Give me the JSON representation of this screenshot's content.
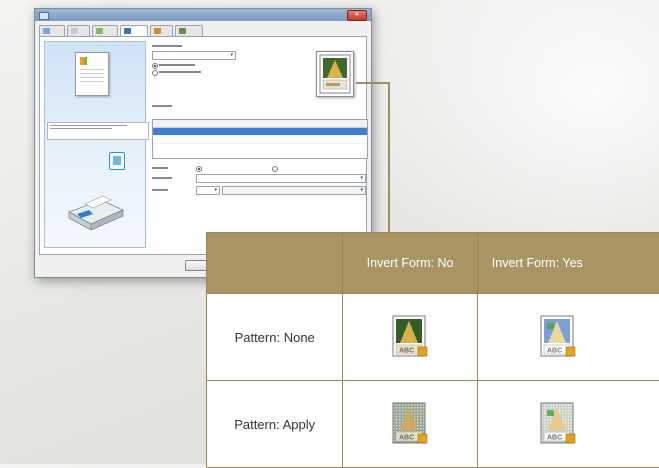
{
  "colors": {
    "table_header": "#a89563",
    "table_border": "#9c8457",
    "connector": "#a08d62",
    "dialog_accent": "#3f7fcf"
  },
  "icons": {
    "form_thumbnail": "form-overlay-preview-icon",
    "printer": "printer-icon",
    "copy": "copy-icon"
  },
  "comparison_table": {
    "columns": [
      "",
      "Invert Form: No",
      "Invert Form: Yes"
    ],
    "rows": [
      {
        "label": "Pattern: None",
        "no_icon": "form-overlay-normal-icon",
        "yes_icon": "form-overlay-inverted-icon"
      },
      {
        "label": "Pattern: Apply",
        "no_icon": "form-overlay-patterned-icon",
        "yes_icon": "form-overlay-patterned-inverted-icon"
      }
    ]
  }
}
